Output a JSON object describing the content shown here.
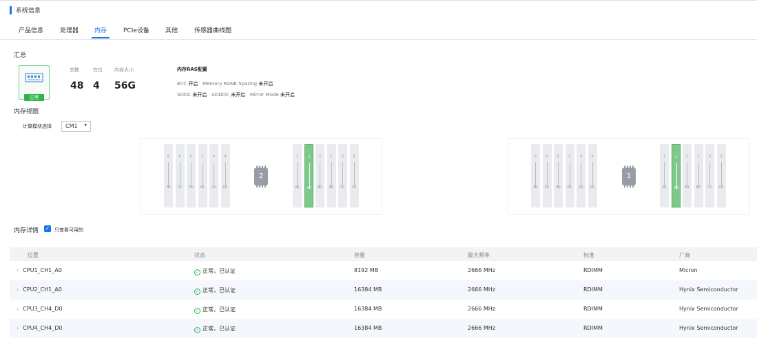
{
  "header": {
    "title": "系统信息"
  },
  "tabs": [
    {
      "label": "产品信息"
    },
    {
      "label": "处理器"
    },
    {
      "label": "内存"
    },
    {
      "label": "PCIe设备"
    },
    {
      "label": "其他"
    },
    {
      "label": "传感器曲线图"
    }
  ],
  "active_tab": "内存",
  "summary": {
    "title": "汇总",
    "status": "正常",
    "total_label": "总数",
    "total": "48",
    "present_label": "在位",
    "present": "4",
    "size_label": "内存大小",
    "size": "56G"
  },
  "ras": {
    "title": "内存RAS配置",
    "ecc_label": "ECC",
    "ecc": "开启",
    "sparing_label": "Memory RANK Sparing",
    "sparing": "未开启",
    "sddc_label": "SDDC",
    "sddc": "未开启",
    "adddc_label": "ADDDC",
    "adddc": "未开启",
    "mirror_label": "Mirror Mode",
    "mirror": "未开启"
  },
  "view": {
    "title": "内存视图",
    "module_label": "计算模块选择",
    "module_value": "CM1",
    "cpus": [
      {
        "cpu": "2",
        "left_slots": [
          {
            "num": "6",
            "label": "F0"
          },
          {
            "num": "6",
            "label": "F1"
          },
          {
            "num": "5",
            "label": "E0"
          },
          {
            "num": "5",
            "label": "E1"
          },
          {
            "num": "4",
            "label": "D0"
          },
          {
            "num": "4",
            "label": "D1"
          }
        ],
        "right_slots": [
          {
            "num": "1",
            "label": "A1"
          },
          {
            "num": "1",
            "label": "A0",
            "active": true
          },
          {
            "num": "2",
            "label": "B1"
          },
          {
            "num": "2",
            "label": "B0"
          },
          {
            "num": "3",
            "label": "C1"
          },
          {
            "num": "3",
            "label": "C0"
          }
        ]
      },
      {
        "cpu": "1",
        "left_slots": [
          {
            "num": "6",
            "label": "F0"
          },
          {
            "num": "6",
            "label": "F1"
          },
          {
            "num": "5",
            "label": "E0"
          },
          {
            "num": "5",
            "label": "E1"
          },
          {
            "num": "4",
            "label": "D0"
          },
          {
            "num": "4",
            "label": "D1"
          }
        ],
        "right_slots": [
          {
            "num": "1",
            "label": "A1"
          },
          {
            "num": "1",
            "label": "A0",
            "active": true
          },
          {
            "num": "2",
            "label": "B1"
          },
          {
            "num": "2",
            "label": "B0"
          },
          {
            "num": "3",
            "label": "C1"
          },
          {
            "num": "3",
            "label": "C0"
          }
        ]
      }
    ]
  },
  "details": {
    "title": "内存详情",
    "only_available_label": "只查看可用的",
    "only_available": true,
    "columns": [
      "位置",
      "状态",
      "容量",
      "最大频率",
      "标准",
      "厂商"
    ],
    "rows": [
      [
        "CPU1_CH1_A0",
        "正常，已认证",
        "8192 MB",
        "2666 MHz",
        "RDIMM",
        "Micron"
      ],
      [
        "CPU2_CH1_A0",
        "正常，已认证",
        "16384 MB",
        "2666 MHz",
        "RDIMM",
        "Hynix Semiconductor"
      ],
      [
        "CPU3_CH4_D0",
        "正常，已认证",
        "16384 MB",
        "2666 MHz",
        "RDIMM",
        "Hynix Semiconductor"
      ],
      [
        "CPU4_CH4_D0",
        "正常，已认证",
        "16384 MB",
        "2666 MHz",
        "RDIMM",
        "Hynix Semiconductor"
      ]
    ]
  },
  "colors": {
    "accent": "#1a73e8",
    "ok": "#2bb54a",
    "slot_active": "#7dc88a"
  }
}
